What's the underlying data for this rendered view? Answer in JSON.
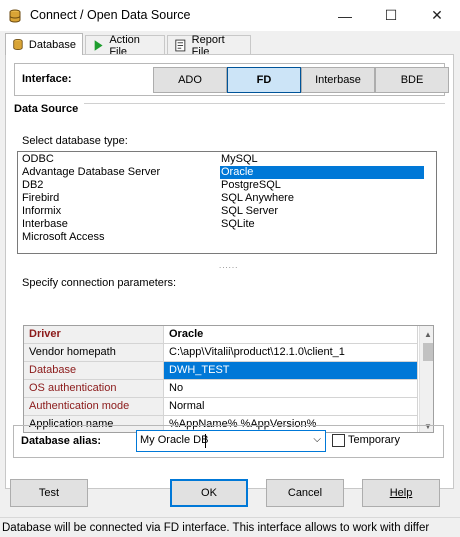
{
  "window": {
    "title": "Connect / Open Data Source",
    "controls": {
      "minimize": "—",
      "maximize": "☐",
      "close": "✕"
    }
  },
  "tabs": [
    {
      "label": "Database",
      "icon": "database-icon",
      "active": true
    },
    {
      "label": "Action File",
      "icon": "play-icon",
      "active": false
    },
    {
      "label": "Report File",
      "icon": "report-icon",
      "active": false
    }
  ],
  "interface": {
    "label": "Interface:",
    "options": [
      "ADO",
      "FD",
      "Interbase",
      "BDE"
    ],
    "selected": "FD"
  },
  "data_source": {
    "title": "Data Source",
    "select_label": "Select database type:",
    "types_col1": [
      "ODBC",
      "Advantage Database Server",
      "DB2",
      "Firebird",
      "Informix",
      "Interbase",
      "Microsoft Access"
    ],
    "types_col2": [
      "MySQL",
      "Oracle",
      "PostgreSQL",
      "SQL Anywhere",
      "SQL Server",
      "SQLite"
    ],
    "selected_type": "Oracle",
    "grip": "......",
    "params_label": "Specify connection parameters:",
    "params": [
      {
        "key": "Driver",
        "value": "Oracle"
      },
      {
        "key": "Vendor homepath",
        "value": "C:\\app\\Vitalii\\product\\12.1.0\\client_1"
      },
      {
        "key": "Database",
        "value": "DWH_TEST"
      },
      {
        "key": "OS authentication",
        "value": "No"
      },
      {
        "key": "Authentication mode",
        "value": "Normal"
      },
      {
        "key": "Application name",
        "value": "%AppName% %AppVersion%"
      }
    ]
  },
  "alias": {
    "label": "Database alias:",
    "value": "My Oracle DB",
    "temporary_label": "Temporary",
    "temporary_checked": false
  },
  "buttons": {
    "test": "Test",
    "ok": "OK",
    "cancel": "Cancel",
    "help": "Help"
  },
  "status": "Database will be connected via FD interface. This interface allows to work with differ",
  "colors": {
    "accent": "#0078d7",
    "key_red": "#8b1a1a",
    "window_bg": "#f0f0f0"
  }
}
